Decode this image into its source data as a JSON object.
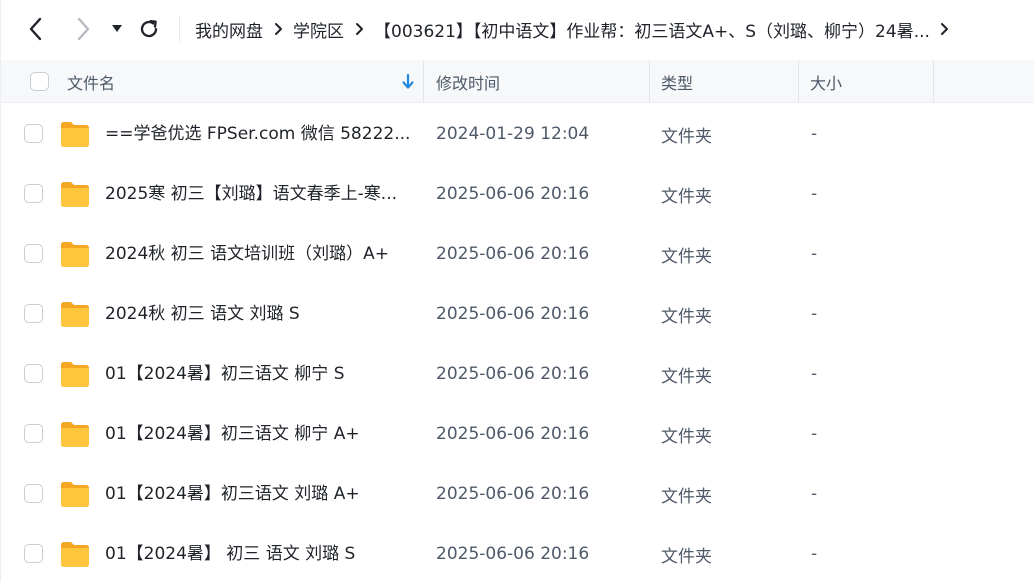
{
  "nav": {
    "breadcrumb": [
      "我的网盘",
      "学院区"
    ],
    "current": "【003621】【初中语文】作业帮：初三语文A+、S（刘璐、柳宁）24暑..."
  },
  "header": {
    "name": "文件名",
    "time": "修改时间",
    "type": "类型",
    "size": "大小"
  },
  "rows": [
    {
      "name": "==学爸优选 FPSer.com 微信 58222...",
      "time": "2024-01-29 12:04",
      "type": "文件夹",
      "size": "-"
    },
    {
      "name": "2025寒 初三【刘璐】语文春季上-寒...",
      "time": "2025-06-06 20:16",
      "type": "文件夹",
      "size": "-"
    },
    {
      "name": "2024秋 初三 语文培训班（刘璐）A+",
      "time": "2025-06-06 20:16",
      "type": "文件夹",
      "size": "-"
    },
    {
      "name": "2024秋 初三 语文 刘璐 S",
      "time": "2025-06-06 20:16",
      "type": "文件夹",
      "size": "-"
    },
    {
      "name": "01【2024暑】初三语文 柳宁 S",
      "time": "2025-06-06 20:16",
      "type": "文件夹",
      "size": "-"
    },
    {
      "name": "01【2024暑】初三语文 柳宁 A+",
      "time": "2025-06-06 20:16",
      "type": "文件夹",
      "size": "-"
    },
    {
      "name": "01【2024暑】初三语文 刘璐 A+",
      "time": "2025-06-06 20:16",
      "type": "文件夹",
      "size": "-"
    },
    {
      "name": "01【2024暑】 初三 语文 刘璐 S",
      "time": "2025-06-06 20:16",
      "type": "文件夹",
      "size": "-"
    }
  ],
  "colors": {
    "folder": "#ffc53d",
    "folder_tab": "#f5a623",
    "sort_arrow": "#1e88e5"
  }
}
